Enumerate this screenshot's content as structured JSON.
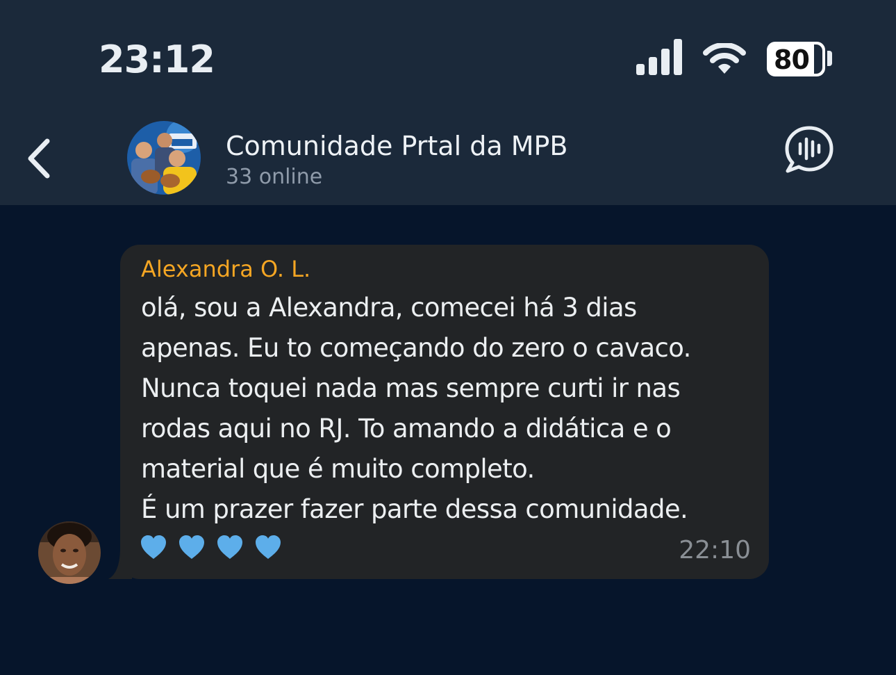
{
  "status_bar": {
    "time": "23:12",
    "battery": "80",
    "icons": [
      "signal-icon",
      "wifi-icon",
      "battery-icon"
    ]
  },
  "header": {
    "back_icon": "chevron-left-icon",
    "avatar_icon": "group-avatar",
    "title": "Comunidade Prtal da MPB",
    "subtitle": "33 online",
    "voice_chat_icon": "voice-chat-icon"
  },
  "message": {
    "sender": "Alexandra O. L.",
    "text": "olá, sou a Alexandra, comecei há 3 dias\napenas. Eu to começando do zero o cavaco.\nNunca toquei nada mas sempre curti ir nas\nrodas aqui no RJ. To amando a didática e o\nmaterial que é muito completo.\nÉ um prazer fazer parte dessa comunidade.",
    "reactions": [
      "blue-heart",
      "blue-heart",
      "blue-heart",
      "blue-heart"
    ],
    "time": "22:10"
  },
  "colors": {
    "header_bg": "#1b293a",
    "chat_bg": "#06152b",
    "bubble_bg": "#222426",
    "sender_name": "#f5a623",
    "heart": "#5daeea"
  }
}
